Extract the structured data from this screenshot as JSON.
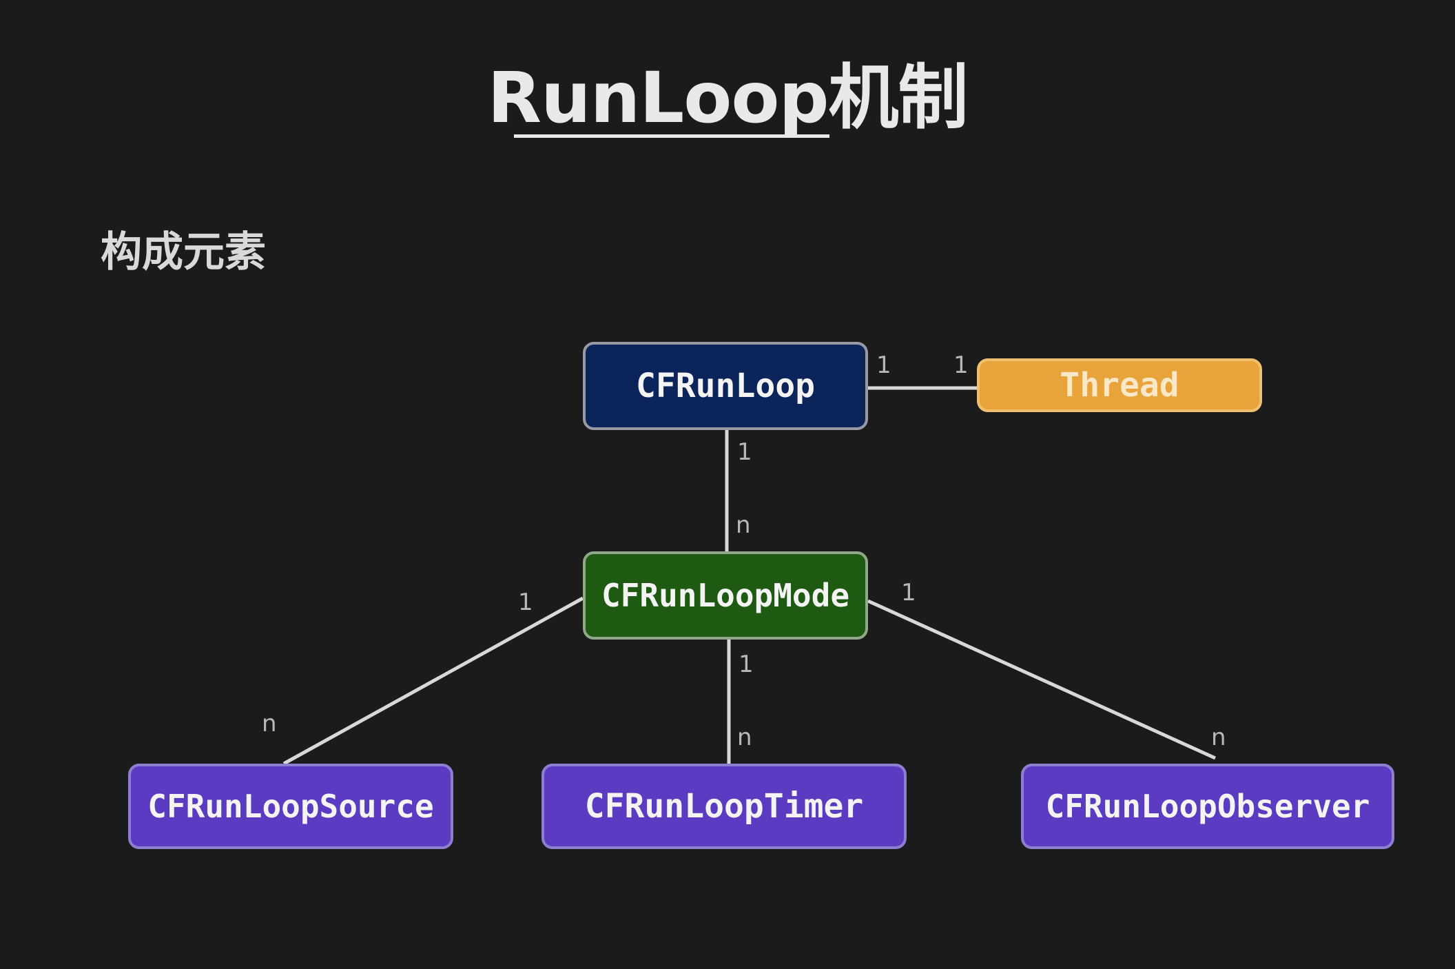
{
  "title": "RunLoop机制",
  "subtitle": "构成元素",
  "nodes": {
    "cfrunloop": "CFRunLoop",
    "thread": "Thread",
    "mode": "CFRunLoopMode",
    "source": "CFRunLoopSource",
    "timer": "CFRunLoopTimer",
    "observer": "CFRunLoopObserver"
  },
  "multiplicities": {
    "runloop_thread_a": "1",
    "runloop_thread_b": "1",
    "runloop_mode_a": "1",
    "runloop_mode_b": "n",
    "mode_source_a": "1",
    "mode_source_b": "n",
    "mode_timer_a": "1",
    "mode_timer_b": "n",
    "mode_observer_a": "1",
    "mode_observer_b": "n"
  },
  "colors": {
    "background": "#1b1b1b",
    "cfrunloop": "#0b2459",
    "thread": "#e8a33a",
    "mode": "#1f5a12",
    "items": "#5a3bc2",
    "connector": "#d8d8d8"
  }
}
